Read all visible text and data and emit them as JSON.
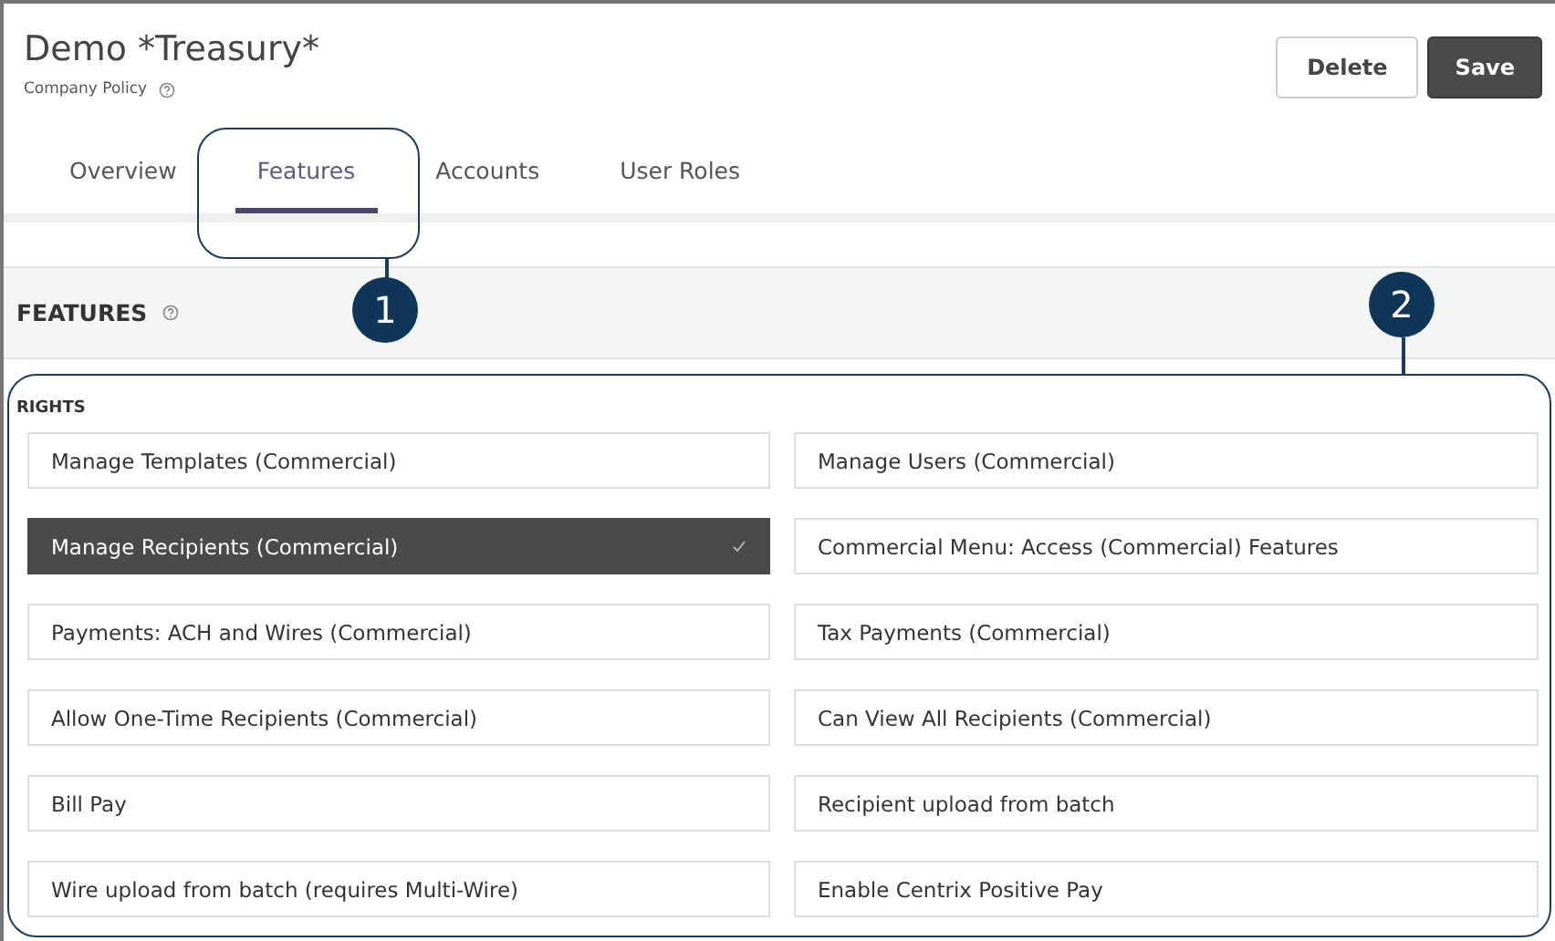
{
  "header": {
    "title": "Demo *Treasury*",
    "subtitle": "Company Policy",
    "buttons": [
      {
        "label": "Delete",
        "kind": "secondary"
      },
      {
        "label": "Save",
        "kind": "primary"
      }
    ]
  },
  "tabs": [
    {
      "label": "Overview",
      "selected": false
    },
    {
      "label": "Features",
      "selected": true
    },
    {
      "label": "Accounts",
      "selected": false
    },
    {
      "label": "User Roles",
      "selected": false
    }
  ],
  "section": {
    "title": "FEATURES"
  },
  "rights": {
    "title": "RIGHTS",
    "items": [
      {
        "label": "Manage Templates (Commercial)",
        "selected": false
      },
      {
        "label": "Manage Users (Commercial)",
        "selected": false
      },
      {
        "label": "Manage Recipients (Commercial)",
        "selected": true
      },
      {
        "label": "Commercial Menu: Access (Commercial) Features",
        "selected": false
      },
      {
        "label": "Payments: ACH and Wires (Commercial)",
        "selected": false
      },
      {
        "label": "Tax Payments (Commercial)",
        "selected": false
      },
      {
        "label": "Allow One-Time Recipients (Commercial)",
        "selected": false
      },
      {
        "label": "Can View All Recipients (Commercial)",
        "selected": false
      },
      {
        "label": "Bill Pay",
        "selected": false
      },
      {
        "label": "Recipient upload from batch",
        "selected": false
      },
      {
        "label": "Wire upload from batch (requires Multi-Wire)",
        "selected": false
      },
      {
        "label": "Enable Centrix Positive Pay",
        "selected": false
      }
    ]
  },
  "callouts": [
    {
      "number": "1"
    },
    {
      "number": "2"
    }
  ]
}
